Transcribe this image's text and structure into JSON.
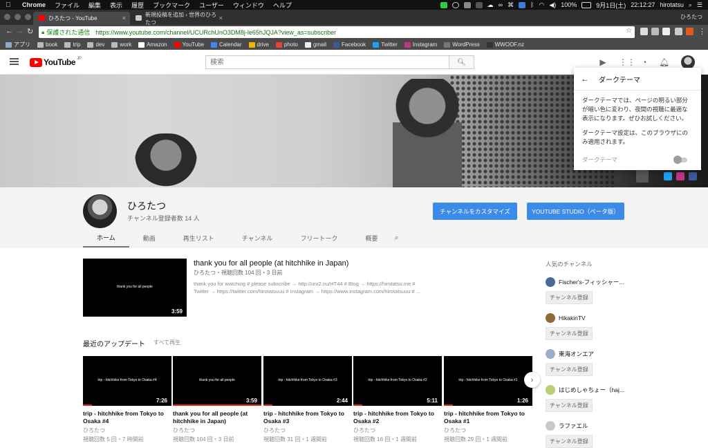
{
  "menubar": {
    "app": "Chrome",
    "items": [
      "ファイル",
      "編集",
      "表示",
      "履歴",
      "ブックマーク",
      "ユーザー",
      "ウィンドウ",
      "ヘルプ"
    ],
    "battery": "100%",
    "date": "9月1日(土)",
    "time": "22:12:27",
    "user": "hirotatsu"
  },
  "tabs": [
    {
      "label": "ひろたつ - YouTube",
      "active": true
    },
    {
      "label": "新規投稿を追加 ‹ 世界のひろたつ",
      "active": false
    }
  ],
  "profile_name": "ひろたつ",
  "address": {
    "secure_label": "保護された通信",
    "url": "https://www.youtube.com/channel/UCURchUnO3DM8j-le65hJQJA?view_as=subscriber"
  },
  "bookmarks": [
    "アプリ",
    "book",
    "trip",
    "dev",
    "work",
    "Amazon",
    "YouTube",
    "Calendar",
    "drive",
    "photo",
    "gmail",
    "Facebook",
    "Twitter",
    "Instagram",
    "WordPress",
    "WWOOF.nz"
  ],
  "masthead": {
    "logo": "YouTube",
    "region": "JP",
    "search_placeholder": "検索"
  },
  "popup": {
    "title": "ダークテーマ",
    "para1": "ダークテーマでは、ページの明るい部分が暗い色に変わり、夜間の視聴に最適な表示になります。ぜひお試しください。",
    "para2": "ダークテーマ設定は、このブラウザにのみ適用されます。",
    "toggle_label": "ダークテーマ",
    "toggle_on": false
  },
  "channel": {
    "name": "ひろたつ",
    "subscribers": "チャンネル登録者数 14 人",
    "customize_btn": "チャンネルをカスタマイズ",
    "studio_btn": "YOUTUBE STUDIO（ベータ版）",
    "tabs": [
      "ホーム",
      "動画",
      "再生リスト",
      "チャンネル",
      "フリートーク",
      "概要"
    ]
  },
  "featured": {
    "thumb_text": "thank you for all people",
    "duration": "3:59",
    "title": "thank you for all people (at hitchhike in Japan)",
    "meta": "ひろたつ・視聴回数 104 回・3 日前",
    "desc_line1": "thank you for watching # please subscribe → http://urx2.nu/HT44 # Blog → https://hirotatsu.me #",
    "desc_line2": "Twitter → https://twitter.com/hirotatsuuu # Instagram → https://www.instagram.com/hirotatsuuu # ..."
  },
  "uploads": {
    "section_title": "最近のアップデート",
    "play_all": "すべて再生",
    "videos": [
      {
        "thumb_text": "trip - hitchhike from Tokyo to Osaka #4",
        "duration": "7:26",
        "title": "trip - hitchhike from Tokyo to Osaka #4",
        "owner": "ひろたつ",
        "stats": "視聴回数 5 回・7 時間前",
        "progress": 0.1
      },
      {
        "thumb_text": "thank you for all people",
        "duration": "3:59",
        "title": "thank you for all people (at hitchhike in Japan)",
        "owner": "ひろたつ",
        "stats": "視聴回数 104 回・3 日前",
        "progress": 1.0
      },
      {
        "thumb_text": "trip - hitchhike from Tokyo to Osaka #3",
        "duration": "2:44",
        "title": "trip - hitchhike from Tokyo to Osaka #3",
        "owner": "ひろたつ",
        "stats": "視聴回数 31 回・1 週間前",
        "progress": 0.1
      },
      {
        "thumb_text": "trip - hitchhike from Tokyo to Osaka #2",
        "duration": "5:11",
        "title": "trip - hitchhike from Tokyo to Osaka #2",
        "owner": "ひろたつ",
        "stats": "視聴回数 16 回・1 週間前",
        "progress": 0.1
      },
      {
        "thumb_text": "trip - hitchhike from Tokyo to Osaka #1",
        "duration": "1:26",
        "title": "trip - hitchhike from Tokyo to Osaka #1",
        "owner": "ひろたつ",
        "stats": "視聴回数 29 回・1 週間前",
        "progress": 0.1
      }
    ]
  },
  "related": {
    "title": "人気のチャンネル",
    "subscribe_label": "チャンネル登録",
    "channels": [
      {
        "name": "Fischer's-フィッシャー..."
      },
      {
        "name": "HikakinTV"
      },
      {
        "name": "東海オンエア"
      },
      {
        "name": "はじめしゃちょー（haj..."
      },
      {
        "name": "ラファエル"
      }
    ]
  },
  "colors": {
    "accent_blue": "#3d8be8",
    "youtube_red": "#ff0000",
    "progress_red": "#e62117"
  }
}
